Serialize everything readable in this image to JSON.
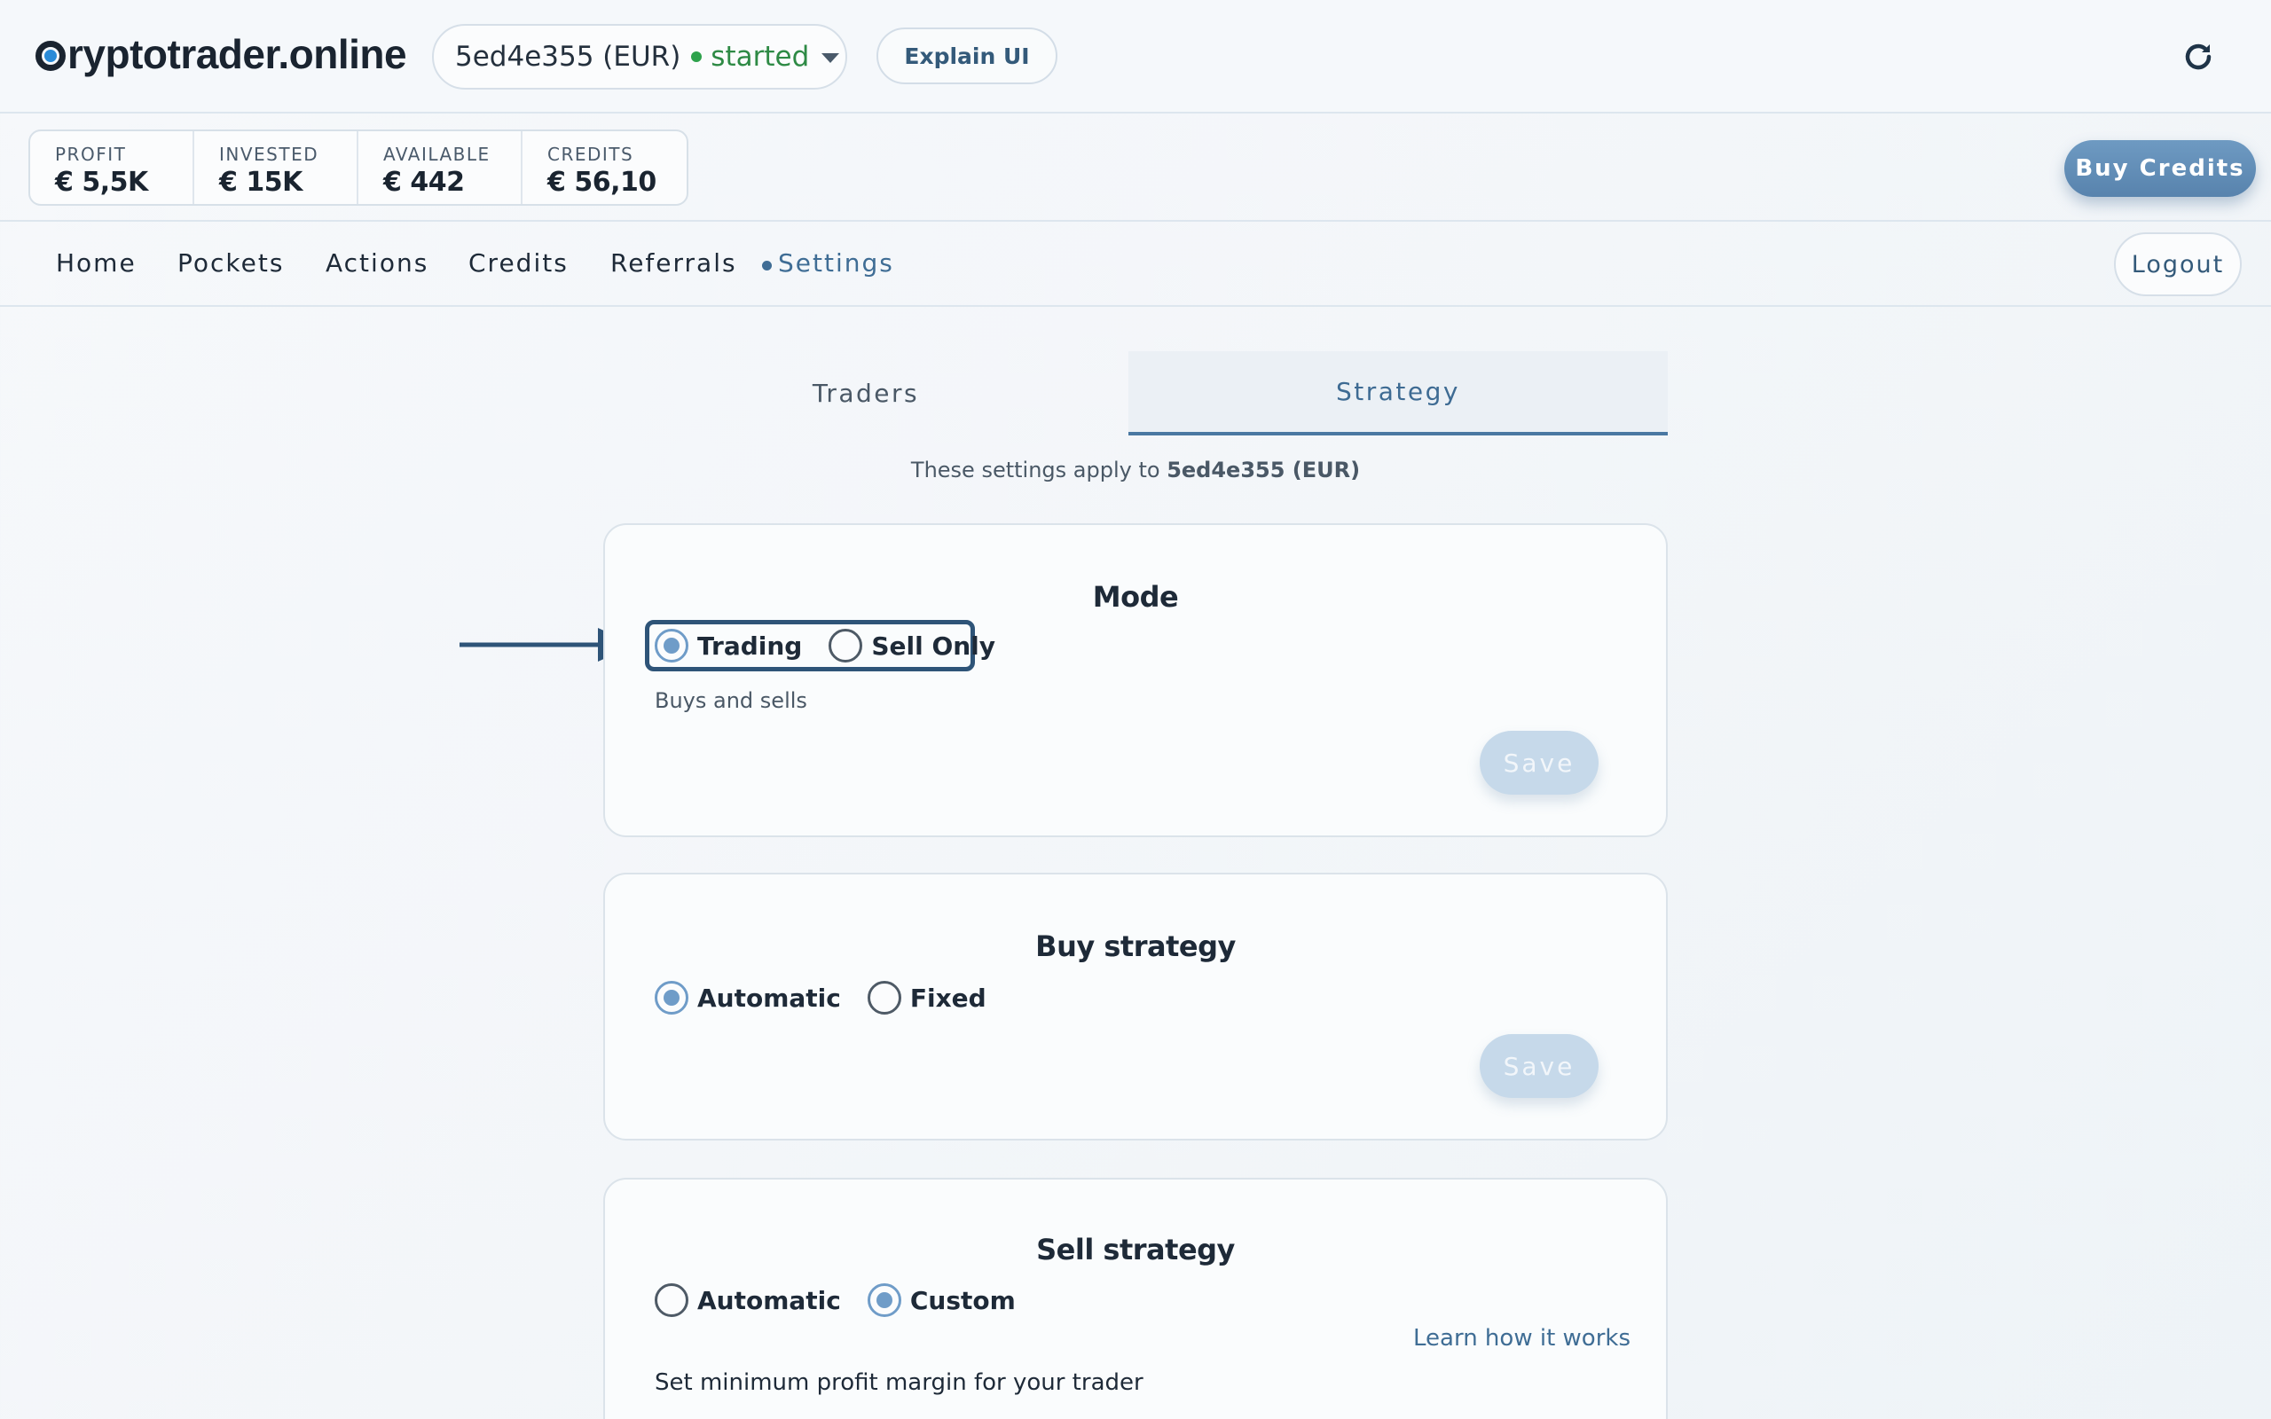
{
  "header": {
    "logo_text": "ryptotrader.online",
    "trader_id": "5ed4e355 (EUR)",
    "trader_status": "started",
    "explain_label": "Explain UI"
  },
  "stats": [
    {
      "label": "PROFIT",
      "value": "€ 5,5K"
    },
    {
      "label": "INVESTED",
      "value": "€ 15K"
    },
    {
      "label": "AVAILABLE",
      "value": "€ 442"
    },
    {
      "label": "CREDITS",
      "value": "€ 56,10"
    }
  ],
  "buy_credits_label": "Buy Credits",
  "nav": {
    "items": [
      "Home",
      "Pockets",
      "Actions",
      "Credits",
      "Referrals",
      "Settings"
    ],
    "active": "Settings",
    "logout_label": "Logout"
  },
  "tabs": {
    "traders": "Traders",
    "strategy": "Strategy",
    "active": "Strategy"
  },
  "scope_note": {
    "prefix": "These settings apply to",
    "trader": "5ed4e355 (EUR)"
  },
  "mode": {
    "title": "Mode",
    "options": [
      "Trading",
      "Sell Only"
    ],
    "selected": "Trading",
    "helper": "Buys and sells",
    "save_label": "Save"
  },
  "buy_strategy": {
    "title": "Buy strategy",
    "options": [
      "Automatic",
      "Fixed"
    ],
    "selected": "Automatic",
    "save_label": "Save"
  },
  "sell_strategy": {
    "title": "Sell strategy",
    "options": [
      "Automatic",
      "Custom"
    ],
    "selected": "Custom",
    "learn_link": "Learn how it works",
    "helper": "Set minimum profit margin for your trader"
  },
  "colors": {
    "accent": "#3f6d95",
    "status_green": "#2e8a45",
    "radio_checked": "#6f9cc8",
    "annotation": "#2e5478"
  },
  "icons": [
    "refresh-icon",
    "chevron-down-icon",
    "arrow-right-icon"
  ]
}
